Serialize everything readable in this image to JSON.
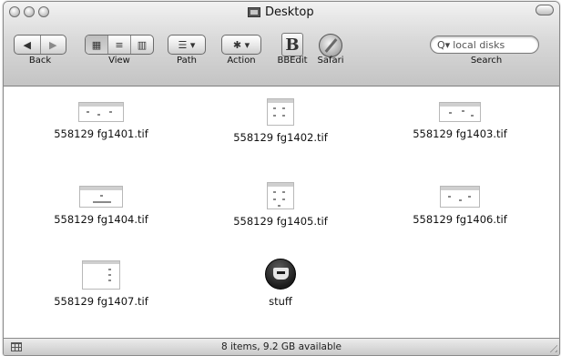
{
  "window": {
    "title": "Desktop",
    "title_icon": "desktop-folder-icon"
  },
  "toolbar": {
    "back_label": "Back",
    "view_label": "View",
    "path_label": "Path",
    "action_label": "Action",
    "bbedit_label": "BBEdit",
    "safari_label": "Safari",
    "search_label": "Search",
    "bbedit_glyph": "B",
    "back_glyph": "◀",
    "forward_glyph": "▶",
    "path_glyph": "☰ ▾",
    "action_glyph": "✱ ▾",
    "view_modes": [
      "icon-view",
      "list-view",
      "column-view"
    ],
    "view_glyphs": [
      "▦",
      "≡",
      "▥"
    ]
  },
  "search": {
    "glyph": "Q▾",
    "value": "local disks"
  },
  "files": [
    {
      "name": "558129 fg1401.tif",
      "icon": "tiff-thumbnail-icon"
    },
    {
      "name": "558129 fg1402.tif",
      "icon": "tiff-thumbnail-icon"
    },
    {
      "name": "558129 fg1403.tif",
      "icon": "tiff-thumbnail-icon"
    },
    {
      "name": "558129 fg1404.tif",
      "icon": "tiff-thumbnail-icon"
    },
    {
      "name": "558129 fg1405.tif",
      "icon": "tiff-thumbnail-icon"
    },
    {
      "name": "558129 fg1406.tif",
      "icon": "tiff-thumbnail-icon"
    },
    {
      "name": "558129 fg1407.tif",
      "icon": "tiff-thumbnail-icon"
    },
    {
      "name": "stuff",
      "icon": "stuff-folder-icon"
    }
  ],
  "status": {
    "text": "8 items, 9.2 GB available"
  }
}
